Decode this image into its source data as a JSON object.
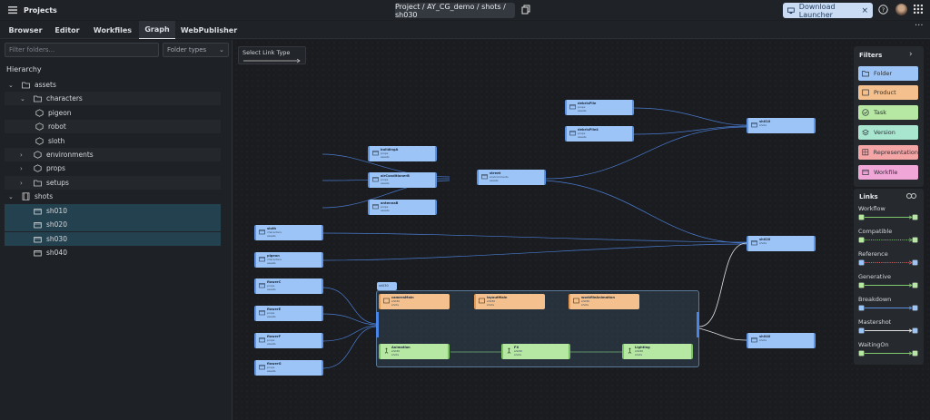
{
  "app": {
    "title": "Projects",
    "project_path": "Project / AY_CG_demo / shots / sh030",
    "download_label": "Download Launcher"
  },
  "tabs": [
    {
      "label": "Browser",
      "active": false
    },
    {
      "label": "Editor",
      "active": false
    },
    {
      "label": "Workfiles",
      "active": false
    },
    {
      "label": "Graph",
      "active": true
    },
    {
      "label": "WebPublisher",
      "active": false
    }
  ],
  "sidebar": {
    "filter_placeholder": "Filter folders...",
    "folder_types_label": "Folder types",
    "hierarchy_title": "Hierarchy",
    "tree": [
      {
        "label": "assets",
        "level": 0,
        "caret": "down",
        "icon": "folder-icon"
      },
      {
        "label": "characters",
        "level": 1,
        "caret": "down",
        "icon": "folder-icon"
      },
      {
        "label": "pigeon",
        "level": 2,
        "caret": "",
        "icon": "asset-icon"
      },
      {
        "label": "robot",
        "level": 2,
        "caret": "",
        "icon": "asset-icon"
      },
      {
        "label": "sloth",
        "level": 2,
        "caret": "",
        "icon": "asset-icon"
      },
      {
        "label": "environments",
        "level": 1,
        "caret": "right",
        "icon": "asset-icon"
      },
      {
        "label": "props",
        "level": 1,
        "caret": "right",
        "icon": "asset-icon"
      },
      {
        "label": "setups",
        "level": 1,
        "caret": "right",
        "icon": "folder-icon"
      },
      {
        "label": "shots",
        "level": 0,
        "caret": "down",
        "icon": "film-icon"
      },
      {
        "label": "sh010",
        "level": 1,
        "caret": "",
        "icon": "clapper-icon",
        "selected": true
      },
      {
        "label": "sh020",
        "level": 1,
        "caret": "",
        "icon": "clapper-icon",
        "selected": true
      },
      {
        "label": "sh030",
        "level": 1,
        "caret": "",
        "icon": "clapper-icon",
        "selected": true
      },
      {
        "label": "sh040",
        "level": 1,
        "caret": "",
        "icon": "clapper-icon",
        "selected": false
      }
    ]
  },
  "graph": {
    "link_type_label": "Select Link Type",
    "group_label": "sh030",
    "nodes": [
      {
        "title": "debrisPile",
        "sub": "props\nassets",
        "kind": "folder"
      },
      {
        "title": "debrisPile4",
        "sub": "props\nassets",
        "kind": "folder"
      },
      {
        "title": "sh010",
        "sub": "shots",
        "kind": "folder"
      },
      {
        "title": "buildingA",
        "sub": "props\nassets",
        "kind": "folder"
      },
      {
        "title": "airConditionerB",
        "sub": "props\nassets",
        "kind": "folder"
      },
      {
        "title": "antennaB",
        "sub": "props\nassets",
        "kind": "folder"
      },
      {
        "title": "street",
        "sub": "environments\nassets",
        "kind": "folder"
      },
      {
        "title": "sloth",
        "sub": "characters\nassets",
        "kind": "folder"
      },
      {
        "title": "pigeon",
        "sub": "characters\nassets",
        "kind": "folder"
      },
      {
        "title": "sh020",
        "sub": "shots",
        "kind": "folder"
      },
      {
        "title": "flowerC",
        "sub": "props\nassets",
        "kind": "folder"
      },
      {
        "title": "flowerE",
        "sub": "props\nassets",
        "kind": "folder"
      },
      {
        "title": "flowerF",
        "sub": "props\nassets",
        "kind": "folder"
      },
      {
        "title": "flowerG",
        "sub": "props\nassets",
        "kind": "folder"
      },
      {
        "title": "sh040",
        "sub": "shots",
        "kind": "folder"
      },
      {
        "title": "cameraMain",
        "sub": "sh030\nshots",
        "kind": "product"
      },
      {
        "title": "layoutMain",
        "sub": "sh030\nshots",
        "kind": "product"
      },
      {
        "title": "workfileAnimation",
        "sub": "sh030\nshots",
        "kind": "product"
      },
      {
        "title": "Animation",
        "sub": "sh030\nshots",
        "kind": "task"
      },
      {
        "title": "FX",
        "sub": "sh030\nshots",
        "kind": "task"
      },
      {
        "title": "Lighting",
        "sub": "sh030\nshots",
        "kind": "task"
      }
    ]
  },
  "filters": {
    "title": "Filters",
    "items": [
      {
        "label": "Folder",
        "color": "#9cc4f7",
        "icon": "folder-icon"
      },
      {
        "label": "Product",
        "color": "#f4c18e",
        "icon": "product-icon"
      },
      {
        "label": "Task",
        "color": "#b6e7a3",
        "icon": "task-icon"
      },
      {
        "label": "Version",
        "color": "#a8e6cf",
        "icon": "version-icon"
      },
      {
        "label": "Representation",
        "color": "#f4a6a6",
        "icon": "representation-icon"
      },
      {
        "label": "Workfile",
        "color": "#f0a7d8",
        "icon": "workfile-icon"
      }
    ]
  },
  "links": {
    "title": "Links",
    "items": [
      {
        "label": "Workflow",
        "color": "#7ec96b",
        "style": "solid"
      },
      {
        "label": "Compatible",
        "color": "#7ec96b",
        "style": "dotted"
      },
      {
        "label": "Reference",
        "color": "#e06b6b",
        "style": "dotted"
      },
      {
        "label": "Generative",
        "color": "#7ec96b",
        "style": "solid"
      },
      {
        "label": "Breakdown",
        "color": "#5b8fe0",
        "style": "solid"
      },
      {
        "label": "Mastershot",
        "color": "#e0e0e0",
        "style": "solid"
      },
      {
        "label": "WaitingOn",
        "color": "#7ec96b",
        "style": "solid"
      }
    ]
  }
}
